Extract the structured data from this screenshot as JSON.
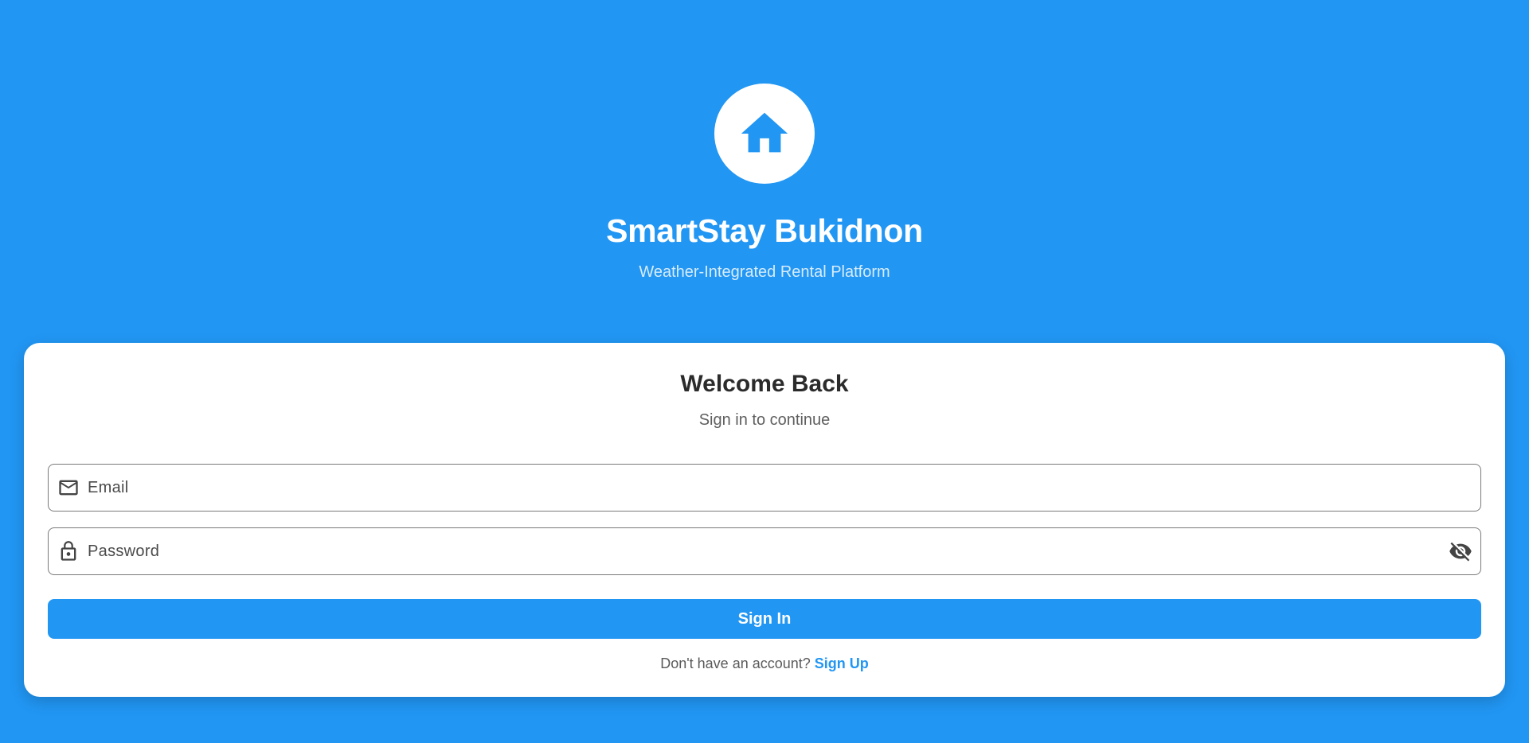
{
  "header": {
    "logo_icon": "home-icon",
    "title": "SmartStay Bukidnon",
    "subtitle": "Weather-Integrated Rental Platform"
  },
  "login_card": {
    "title": "Welcome Back",
    "subtitle": "Sign in to continue",
    "email": {
      "icon": "mail-icon",
      "value": "",
      "placeholder": "Email"
    },
    "password": {
      "icon": "lock-icon",
      "value": "",
      "placeholder": "Password",
      "visibility_icon": "visibility-off-icon"
    },
    "signin_label": "Sign In",
    "signup_prompt": "Don't have an account?",
    "signup_link": "Sign Up"
  },
  "colors": {
    "background": "#2196F3",
    "accent": "#2196F3",
    "card": "#FFFFFF"
  }
}
